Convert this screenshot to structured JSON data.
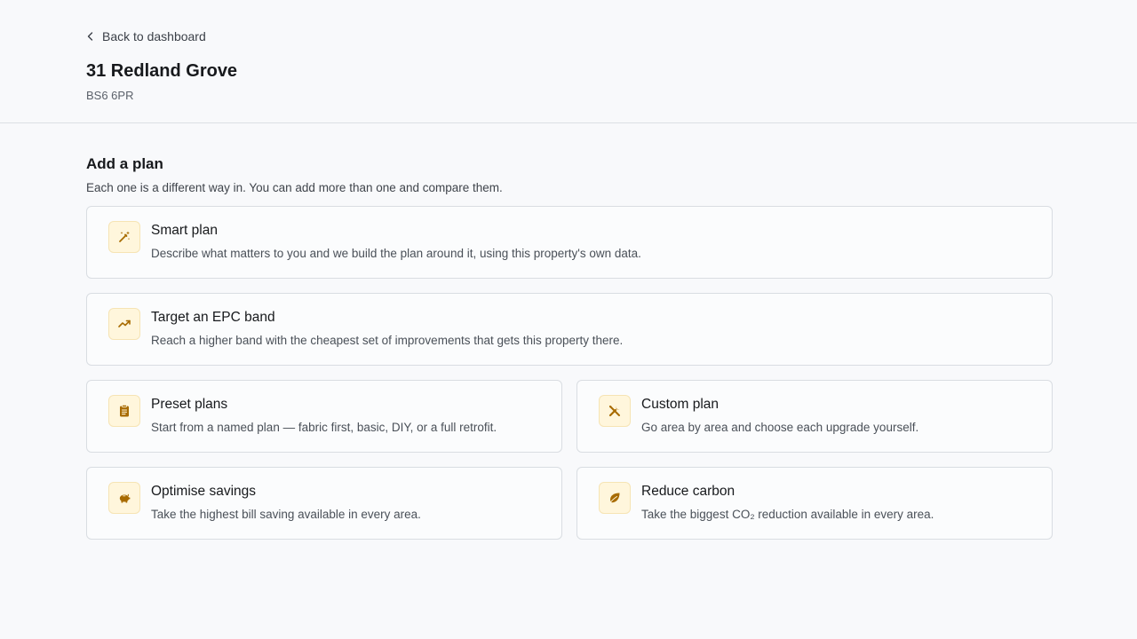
{
  "header": {
    "back_label": "Back to dashboard",
    "title": "31 Redland Grove",
    "postcode": "BS6 6PR"
  },
  "section": {
    "title": "Add a plan",
    "subtitle": "Each one is a different way in. You can add more than one and compare them."
  },
  "cards": [
    {
      "icon": "magic-wand-icon",
      "title": "Smart plan",
      "desc": "Describe what matters to you and we build the plan around it, using this property's own data."
    },
    {
      "icon": "trending-up-icon",
      "title": "Target an EPC band",
      "desc": "Reach a higher band with the cheapest set of improvements that gets this property there."
    },
    {
      "icon": "clipboard-icon",
      "title": "Preset plans",
      "desc": "Start from a named plan — fabric first, basic, DIY, or a full retrofit."
    },
    {
      "icon": "tools-icon",
      "title": "Custom plan",
      "desc": "Go area by area and choose each upgrade yourself."
    },
    {
      "icon": "piggy-bank-icon",
      "title": "Optimise savings",
      "desc": "Take the highest bill saving available in every area."
    },
    {
      "icon": "leaf-icon",
      "title": "Reduce carbon",
      "desc": "Take the biggest CO₂ reduction available in every area."
    }
  ],
  "colors": {
    "accent": "#b8860b",
    "icon_bg": "#fff6dc",
    "background": "#f8f9fb"
  }
}
